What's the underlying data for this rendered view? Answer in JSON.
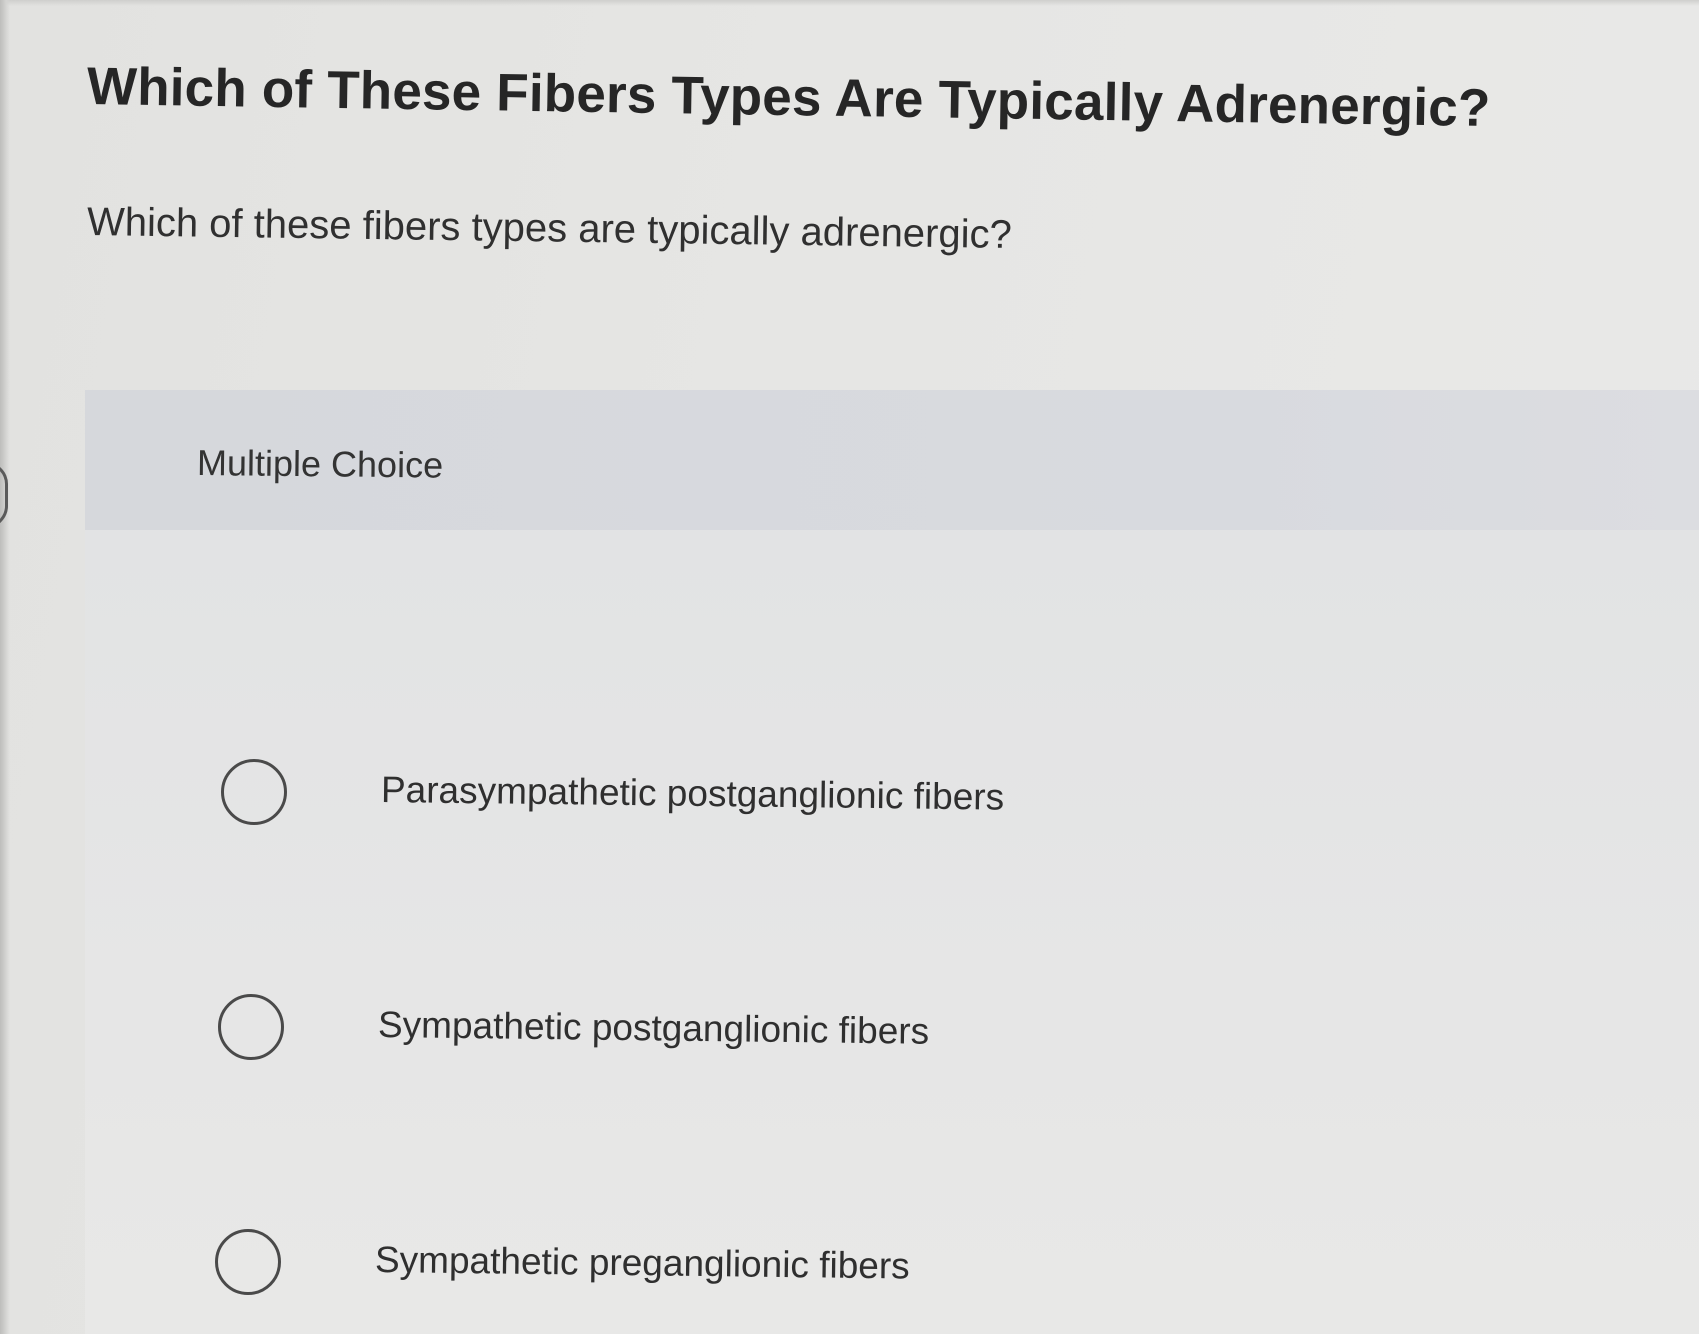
{
  "page": {
    "title": "Which of These Fibers Types Are Typically Adrenergic?",
    "question": "Which of these fibers types are typically adrenergic?"
  },
  "answer_panel": {
    "header_label": "Multiple Choice",
    "options": [
      {
        "label": "Parasympathetic postganglionic fibers",
        "selected": false
      },
      {
        "label": "Sympathetic postganglionic fibers",
        "selected": false
      },
      {
        "label": "Sympathetic preganglionic fibers",
        "selected": false
      }
    ]
  }
}
